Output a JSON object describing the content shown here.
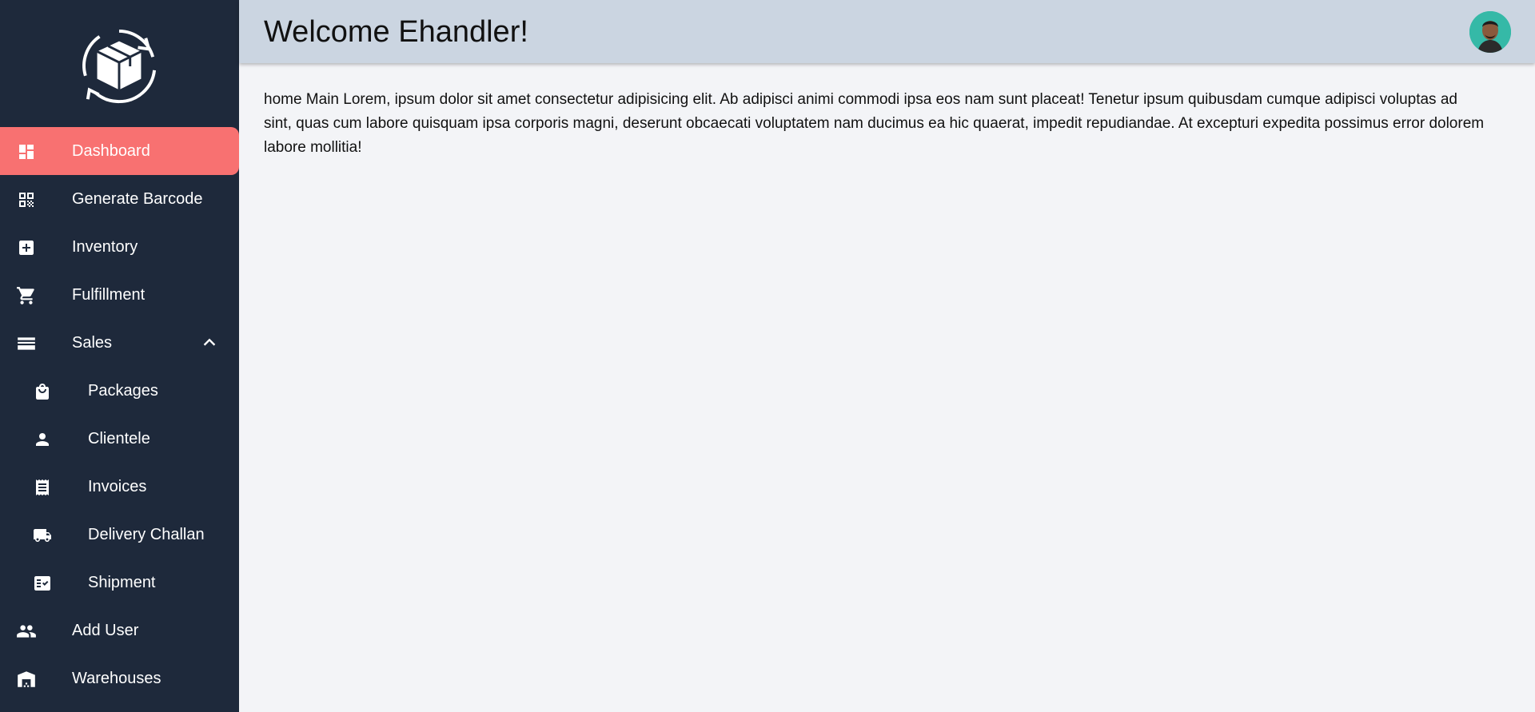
{
  "header": {
    "title": "Welcome Ehandler!"
  },
  "sidebar": {
    "items": [
      {
        "label": "Dashboard",
        "icon": "dashboard-icon",
        "active": true
      },
      {
        "label": "Generate Barcode",
        "icon": "qr-code-icon"
      },
      {
        "label": "Inventory",
        "icon": "add-box-icon"
      },
      {
        "label": "Fulfillment",
        "icon": "shopping-cart-icon"
      },
      {
        "label": "Sales",
        "icon": "credit-card-icon",
        "expanded": true
      },
      {
        "label": "Packages",
        "icon": "shopping-bag-icon"
      },
      {
        "label": "Clientele",
        "icon": "person-icon"
      },
      {
        "label": "Invoices",
        "icon": "receipt-icon"
      },
      {
        "label": "Delivery Challan",
        "icon": "truck-icon"
      },
      {
        "label": "Shipment",
        "icon": "fact-check-icon"
      },
      {
        "label": "Add User",
        "icon": "group-icon"
      },
      {
        "label": "Warehouses",
        "icon": "warehouse-icon"
      }
    ]
  },
  "main": {
    "body_text": "home Main Lorem, ipsum dolor sit amet consectetur adipisicing elit. Ab adipisci animi commodi ipsa eos nam sunt placeat! Tenetur ipsum quibusdam cumque adipisci voluptas ad sint, quas cum labore quisquam ipsa corporis magni, deserunt obcaecati voluptatem nam ducimus ea hic quaerat, impedit repudiandae. At excepturi expedita possimus error dolorem labore mollitia!"
  },
  "colors": {
    "sidebar_bg": "#1e293b",
    "active_item": "#f87171",
    "topbar_bg": "#cbd5e1",
    "page_bg": "#f3f4f7"
  }
}
